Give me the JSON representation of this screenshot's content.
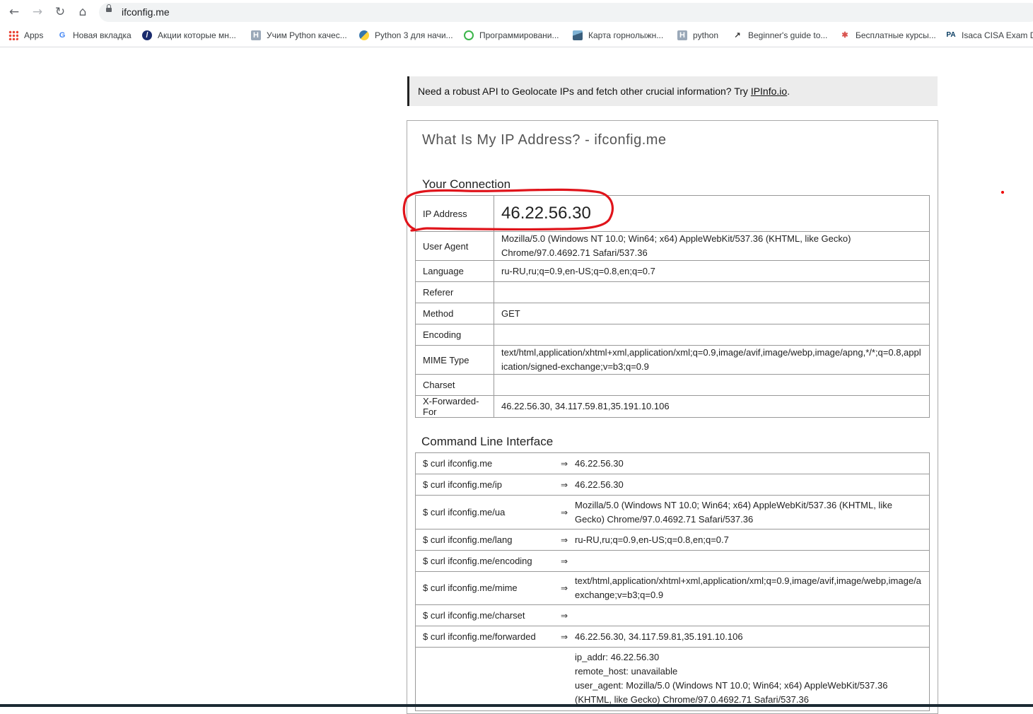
{
  "browser": {
    "url": "ifconfig.me",
    "bookmarks": [
      {
        "label": "Apps",
        "icon": "apps-grid-icon"
      },
      {
        "label": "Новая вкладка",
        "icon": "google-icon"
      },
      {
        "label": "Акции которые мн...",
        "icon": "slash-logo-icon"
      },
      {
        "label": "Учим Python качес...",
        "icon": "h-logo-icon"
      },
      {
        "label": "Python 3 для начи...",
        "icon": "python-icon"
      },
      {
        "label": "Программировани...",
        "icon": "green-logo-icon"
      },
      {
        "label": "Карта горнолыжн...",
        "icon": "mountain-icon"
      },
      {
        "label": "python",
        "icon": "h-logo-icon"
      },
      {
        "label": "Beginner's guide to...",
        "icon": "chart-icon"
      },
      {
        "label": "Бесплатные курсы...",
        "icon": "spider-icon"
      },
      {
        "label": "Isaca CISA Exam Du",
        "icon": "pa-logo-icon"
      }
    ]
  },
  "promo": {
    "text": "Need a robust API to Geolocate IPs and fetch other crucial information? Try ",
    "link": "IPInfo.io",
    "suffix": "."
  },
  "page": {
    "title": "What Is My IP Address? - ifconfig.me",
    "connection_title": "Your Connection",
    "cli_title": "Command Line Interface"
  },
  "connection": [
    {
      "key": "IP Address",
      "value": "46.22.56.30"
    },
    {
      "key": "User Agent",
      "value": "Mozilla/5.0 (Windows NT 10.0; Win64; x64) AppleWebKit/537.36 (KHTML, like Gecko) Chrome/97.0.4692.71 Safari/537.36"
    },
    {
      "key": "Language",
      "value": "ru-RU,ru;q=0.9,en-US;q=0.8,en;q=0.7"
    },
    {
      "key": "Referer",
      "value": ""
    },
    {
      "key": "Method",
      "value": "GET"
    },
    {
      "key": "Encoding",
      "value": ""
    },
    {
      "key": "MIME Type",
      "value": "text/html,application/xhtml+xml,application/xml;q=0.9,image/avif,image/webp,image/apng,*/*;q=0.8,application/signed-exchange;v=b3;q=0.9"
    },
    {
      "key": "Charset",
      "value": ""
    },
    {
      "key": "X-Forwarded-For",
      "value": "46.22.56.30, 34.117.59.81,35.191.10.106"
    }
  ],
  "cli": [
    {
      "cmd": "$ curl ifconfig.me",
      "arrow": "⇒",
      "out": "46.22.56.30"
    },
    {
      "cmd": "$ curl ifconfig.me/ip",
      "arrow": "⇒",
      "out": "46.22.56.30"
    },
    {
      "cmd": "$ curl ifconfig.me/ua",
      "arrow": "⇒",
      "out": "Mozilla/5.0 (Windows NT 10.0; Win64; x64) AppleWebKit/537.36 (KHTML, like Gecko) Chrome/97.0.4692.71 Safari/537.36"
    },
    {
      "cmd": "$ curl ifconfig.me/lang",
      "arrow": "⇒",
      "out": "ru-RU,ru;q=0.9,en-US;q=0.8,en;q=0.7"
    },
    {
      "cmd": "$ curl ifconfig.me/encoding",
      "arrow": "⇒",
      "out": ""
    },
    {
      "cmd": "$ curl ifconfig.me/mime",
      "arrow": "⇒",
      "out_line1": "text/html,application/xhtml+xml,application/xml;q=0.9,image/avif,image/webp,image/a",
      "out_line2": "exchange;v=b3;q=0.9"
    },
    {
      "cmd": "$ curl ifconfig.me/charset",
      "arrow": "⇒",
      "out": ""
    },
    {
      "cmd": "$ curl ifconfig.me/forwarded",
      "arrow": "⇒",
      "out": "46.22.56.30, 34.117.59.81,35.191.10.106"
    }
  ],
  "cli_all": [
    "ip_addr: 46.22.56.30",
    "remote_host: unavailable",
    "user_agent: Mozilla/5.0 (Windows NT 10.0; Win64; x64) AppleWebKit/537.36 (KHTML, like Gecko) Chrome/97.0.4692.71 Safari/537.36"
  ],
  "colors": {
    "annotation": "#e0141b",
    "promo_bg": "#ececec"
  }
}
